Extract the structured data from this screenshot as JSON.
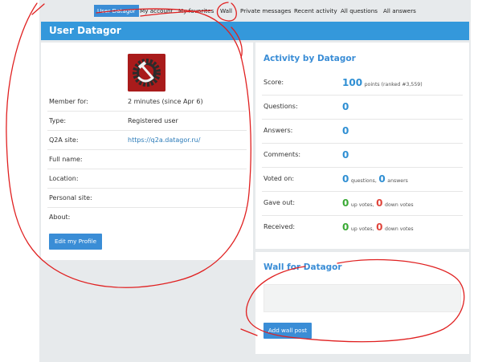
{
  "nav": {
    "items": [
      {
        "label": "User Datagor",
        "active": true
      },
      {
        "label": "My account",
        "active": false
      },
      {
        "label": "My favorites",
        "active": false
      },
      {
        "label": "Wall",
        "active": false
      },
      {
        "label": "Private messages",
        "active": false
      },
      {
        "label": "Recent activity",
        "active": false
      },
      {
        "label": "All questions",
        "active": false
      },
      {
        "label": "All answers",
        "active": false
      }
    ]
  },
  "page": {
    "title": "User Datagor"
  },
  "profile": {
    "avatar_icon": "hammer-sickle-gear-icon",
    "rows": [
      {
        "label": "Member for:",
        "value": "2 minutes (since Apr 6)"
      },
      {
        "label": "Type:",
        "value": "Registered user"
      },
      {
        "label": "Q2A site:",
        "value": "https://q2a.datagor.ru/"
      },
      {
        "label": "Full name:",
        "value": ""
      },
      {
        "label": "Location:",
        "value": ""
      },
      {
        "label": "Personal site:",
        "value": ""
      },
      {
        "label": "About:",
        "value": ""
      }
    ],
    "edit_button": "Edit my Profile"
  },
  "activity": {
    "title": "Activity by Datagor",
    "score": {
      "label": "Score:",
      "value": "100",
      "unit": "points (ranked #3,559)"
    },
    "questions": {
      "label": "Questions:",
      "value": "0"
    },
    "answers": {
      "label": "Answers:",
      "value": "0"
    },
    "comments": {
      "label": "Comments:",
      "value": "0"
    },
    "voted_on": {
      "label": "Voted on:",
      "questions": "0",
      "questions_unit": "questions,",
      "answers": "0",
      "answers_unit": "answers"
    },
    "gave_out": {
      "label": "Gave out:",
      "up": "0",
      "up_unit": "up votes,",
      "down": "0",
      "down_unit": "down votes"
    },
    "received": {
      "label": "Received:",
      "up": "0",
      "up_unit": "up votes,",
      "down": "0",
      "down_unit": "down votes"
    }
  },
  "wall": {
    "title": "Wall for Datagor",
    "textarea_value": "",
    "add_button": "Add wall post"
  },
  "colors": {
    "accent": "#3498db",
    "link": "#2a7ab8",
    "positive": "#3aaa35",
    "negative": "#e0463c",
    "annotation": "#e02020"
  }
}
